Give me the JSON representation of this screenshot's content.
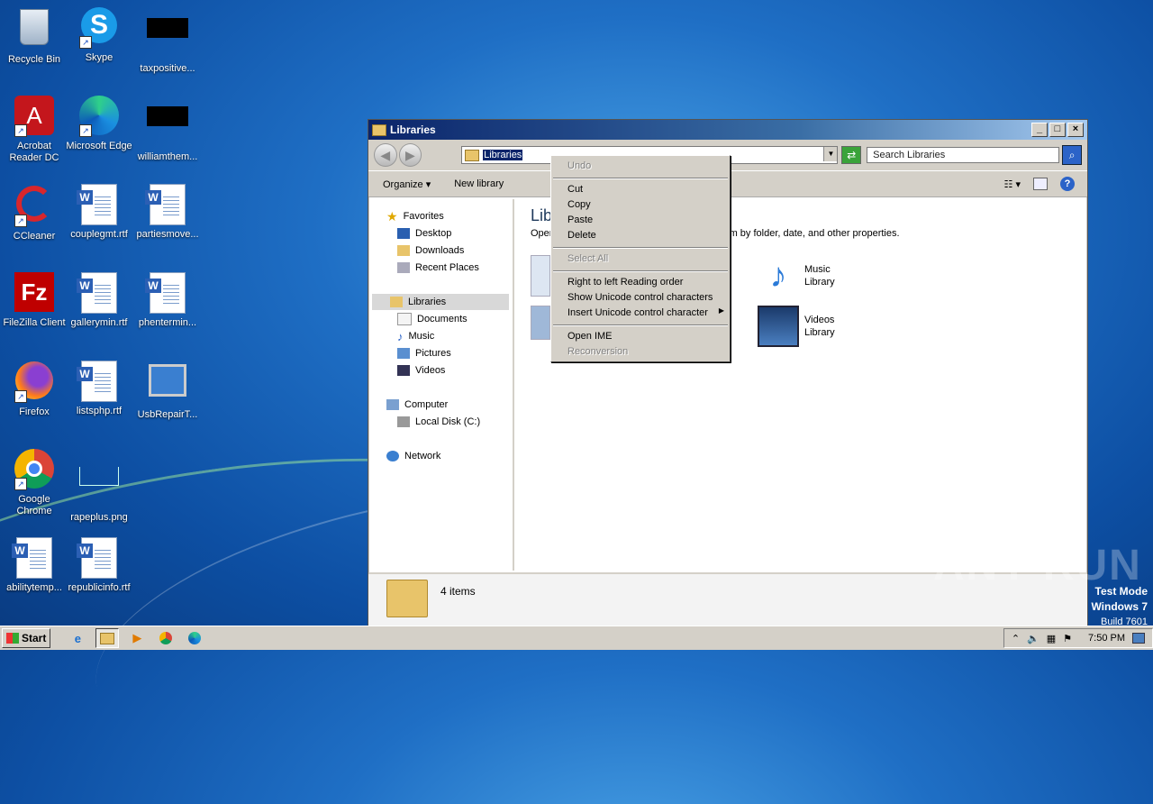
{
  "desktop": {
    "icons": [
      {
        "label": "Recycle Bin"
      },
      {
        "label": "Skype"
      },
      {
        "label": "taxpositive..."
      },
      {
        "label": "Acrobat Reader DC"
      },
      {
        "label": "Microsoft Edge"
      },
      {
        "label": "williamthem..."
      },
      {
        "label": "CCleaner"
      },
      {
        "label": "couplegmt.rtf"
      },
      {
        "label": "partiesmove..."
      },
      {
        "label": "FileZilla Client"
      },
      {
        "label": "gallerymin.rtf"
      },
      {
        "label": "phentermin..."
      },
      {
        "label": "Firefox"
      },
      {
        "label": "listsphp.rtf"
      },
      {
        "label": "UsbRepairT..."
      },
      {
        "label": "Google Chrome"
      },
      {
        "label": "rapeplus.png"
      },
      {
        "label": "abilitytemp..."
      },
      {
        "label": "republicinfo.rtf"
      }
    ]
  },
  "window": {
    "title": "Libraries",
    "address": "Libraries",
    "search_placeholder": "Search Libraries",
    "toolbar": {
      "organize": "Organize",
      "new_library": "New library"
    },
    "nav": {
      "favorites": "Favorites",
      "desktop": "Desktop",
      "downloads": "Downloads",
      "recent": "Recent Places",
      "libraries": "Libraries",
      "documents": "Documents",
      "music": "Music",
      "pictures": "Pictures",
      "videos": "Videos",
      "computer": "Computer",
      "local_disk": "Local Disk (C:)",
      "network": "Network"
    },
    "content": {
      "heading": "Lib",
      "subline_left": "Oper",
      "subline_right": "em by folder, date, and other properties.",
      "music_lib": {
        "name": "Music",
        "type": "Library"
      },
      "videos_lib": {
        "name": "Videos",
        "type": "Library"
      }
    },
    "status": {
      "count": "4 items"
    }
  },
  "context_menu": {
    "undo": "Undo",
    "cut": "Cut",
    "copy": "Copy",
    "paste": "Paste",
    "delete": "Delete",
    "select_all": "Select All",
    "rtl": "Right to left Reading order",
    "show_unicode": "Show Unicode control characters",
    "insert_unicode": "Insert Unicode control character",
    "open_ime": "Open IME",
    "reconversion": "Reconversion"
  },
  "watermark": {
    "text": "ANY RUN",
    "test_mode": "Test Mode",
    "os": "Windows 7",
    "build": "Build 7601"
  },
  "taskbar": {
    "start": "Start",
    "clock": "7:50 PM"
  }
}
